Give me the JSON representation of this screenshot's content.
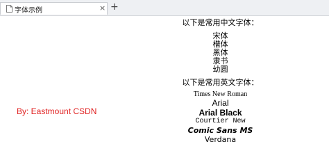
{
  "tab": {
    "title": "字体示例",
    "close": "×",
    "new_tab": "+"
  },
  "byline": "By: Eastmount CSDN",
  "chinese": {
    "heading": "以下是常用中文字体：",
    "fonts": [
      "宋体",
      "楷体",
      "黑体",
      "隶书",
      "幼圆"
    ]
  },
  "english": {
    "heading": "以下是常用英文字体：",
    "fonts": [
      "Times New Roman",
      "Arial",
      "Arial Black",
      "Courtier New",
      "Comic Sans MS",
      "Verdana"
    ]
  },
  "colors": {
    "byline": "#e02020",
    "tabbar": "#eef0f3"
  }
}
